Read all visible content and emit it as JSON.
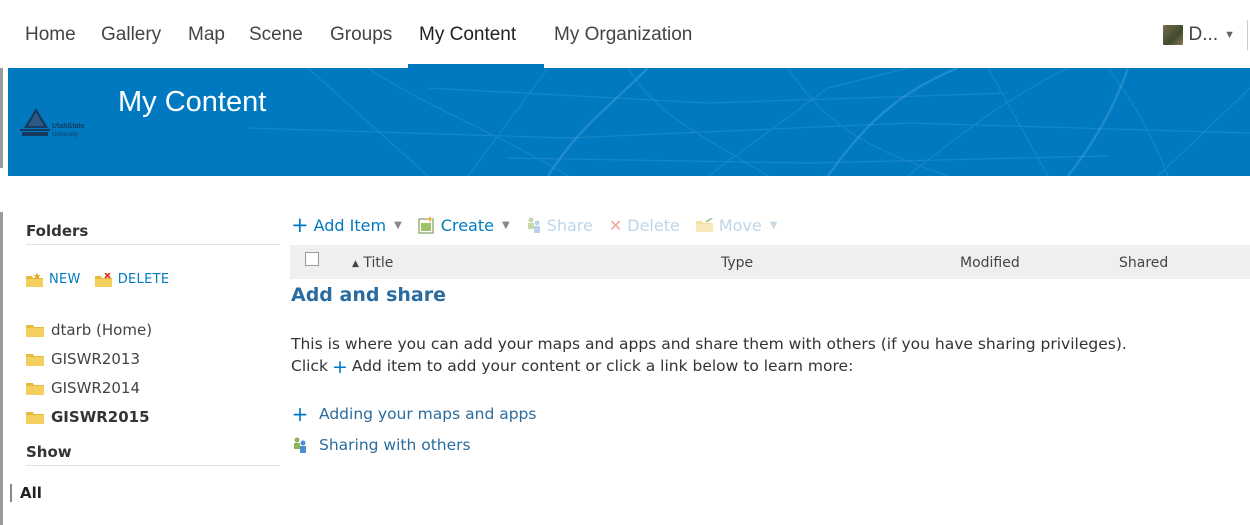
{
  "nav": {
    "items": [
      {
        "label": "Home"
      },
      {
        "label": "Gallery"
      },
      {
        "label": "Map"
      },
      {
        "label": "Scene"
      },
      {
        "label": "Groups"
      },
      {
        "label": "My Content"
      },
      {
        "label": "My Organization"
      }
    ],
    "active": "My Content",
    "user_label": "D..."
  },
  "banner": {
    "title": "My Content",
    "logo_text": "UtahState University"
  },
  "sidebar": {
    "folders_heading": "Folders",
    "new_label": "NEW",
    "delete_label": "DELETE",
    "folders": [
      {
        "label": "dtarb (Home)",
        "selected": false
      },
      {
        "label": "GISWR2013",
        "selected": false
      },
      {
        "label": "GISWR2014",
        "selected": false
      },
      {
        "label": "GISWR2015",
        "selected": true
      }
    ],
    "show_heading": "Show",
    "show_selected": "All"
  },
  "toolbar": {
    "add_item": "Add Item",
    "create": "Create",
    "share": "Share",
    "delete": "Delete",
    "move": "Move"
  },
  "table": {
    "columns": {
      "title": "Title",
      "type": "Type",
      "modified": "Modified",
      "shared": "Shared"
    },
    "sort_indicator": "▲"
  },
  "content": {
    "title": "Add and share",
    "desc_line1": "This is where you can add your maps and apps and share them with others (if you have sharing privileges).",
    "desc_line2_a": "Click",
    "desc_line2_b": "Add item to add your content or click a link below to learn more:",
    "links": [
      {
        "label": "Adding your maps and apps",
        "icon": "plus-icon"
      },
      {
        "label": "Sharing with others",
        "icon": "share-icon"
      }
    ]
  },
  "colors": {
    "accent": "#0079c1",
    "link": "#2a6ca0",
    "disabled": "#bcd6ea",
    "header_bg": "#efefef"
  }
}
